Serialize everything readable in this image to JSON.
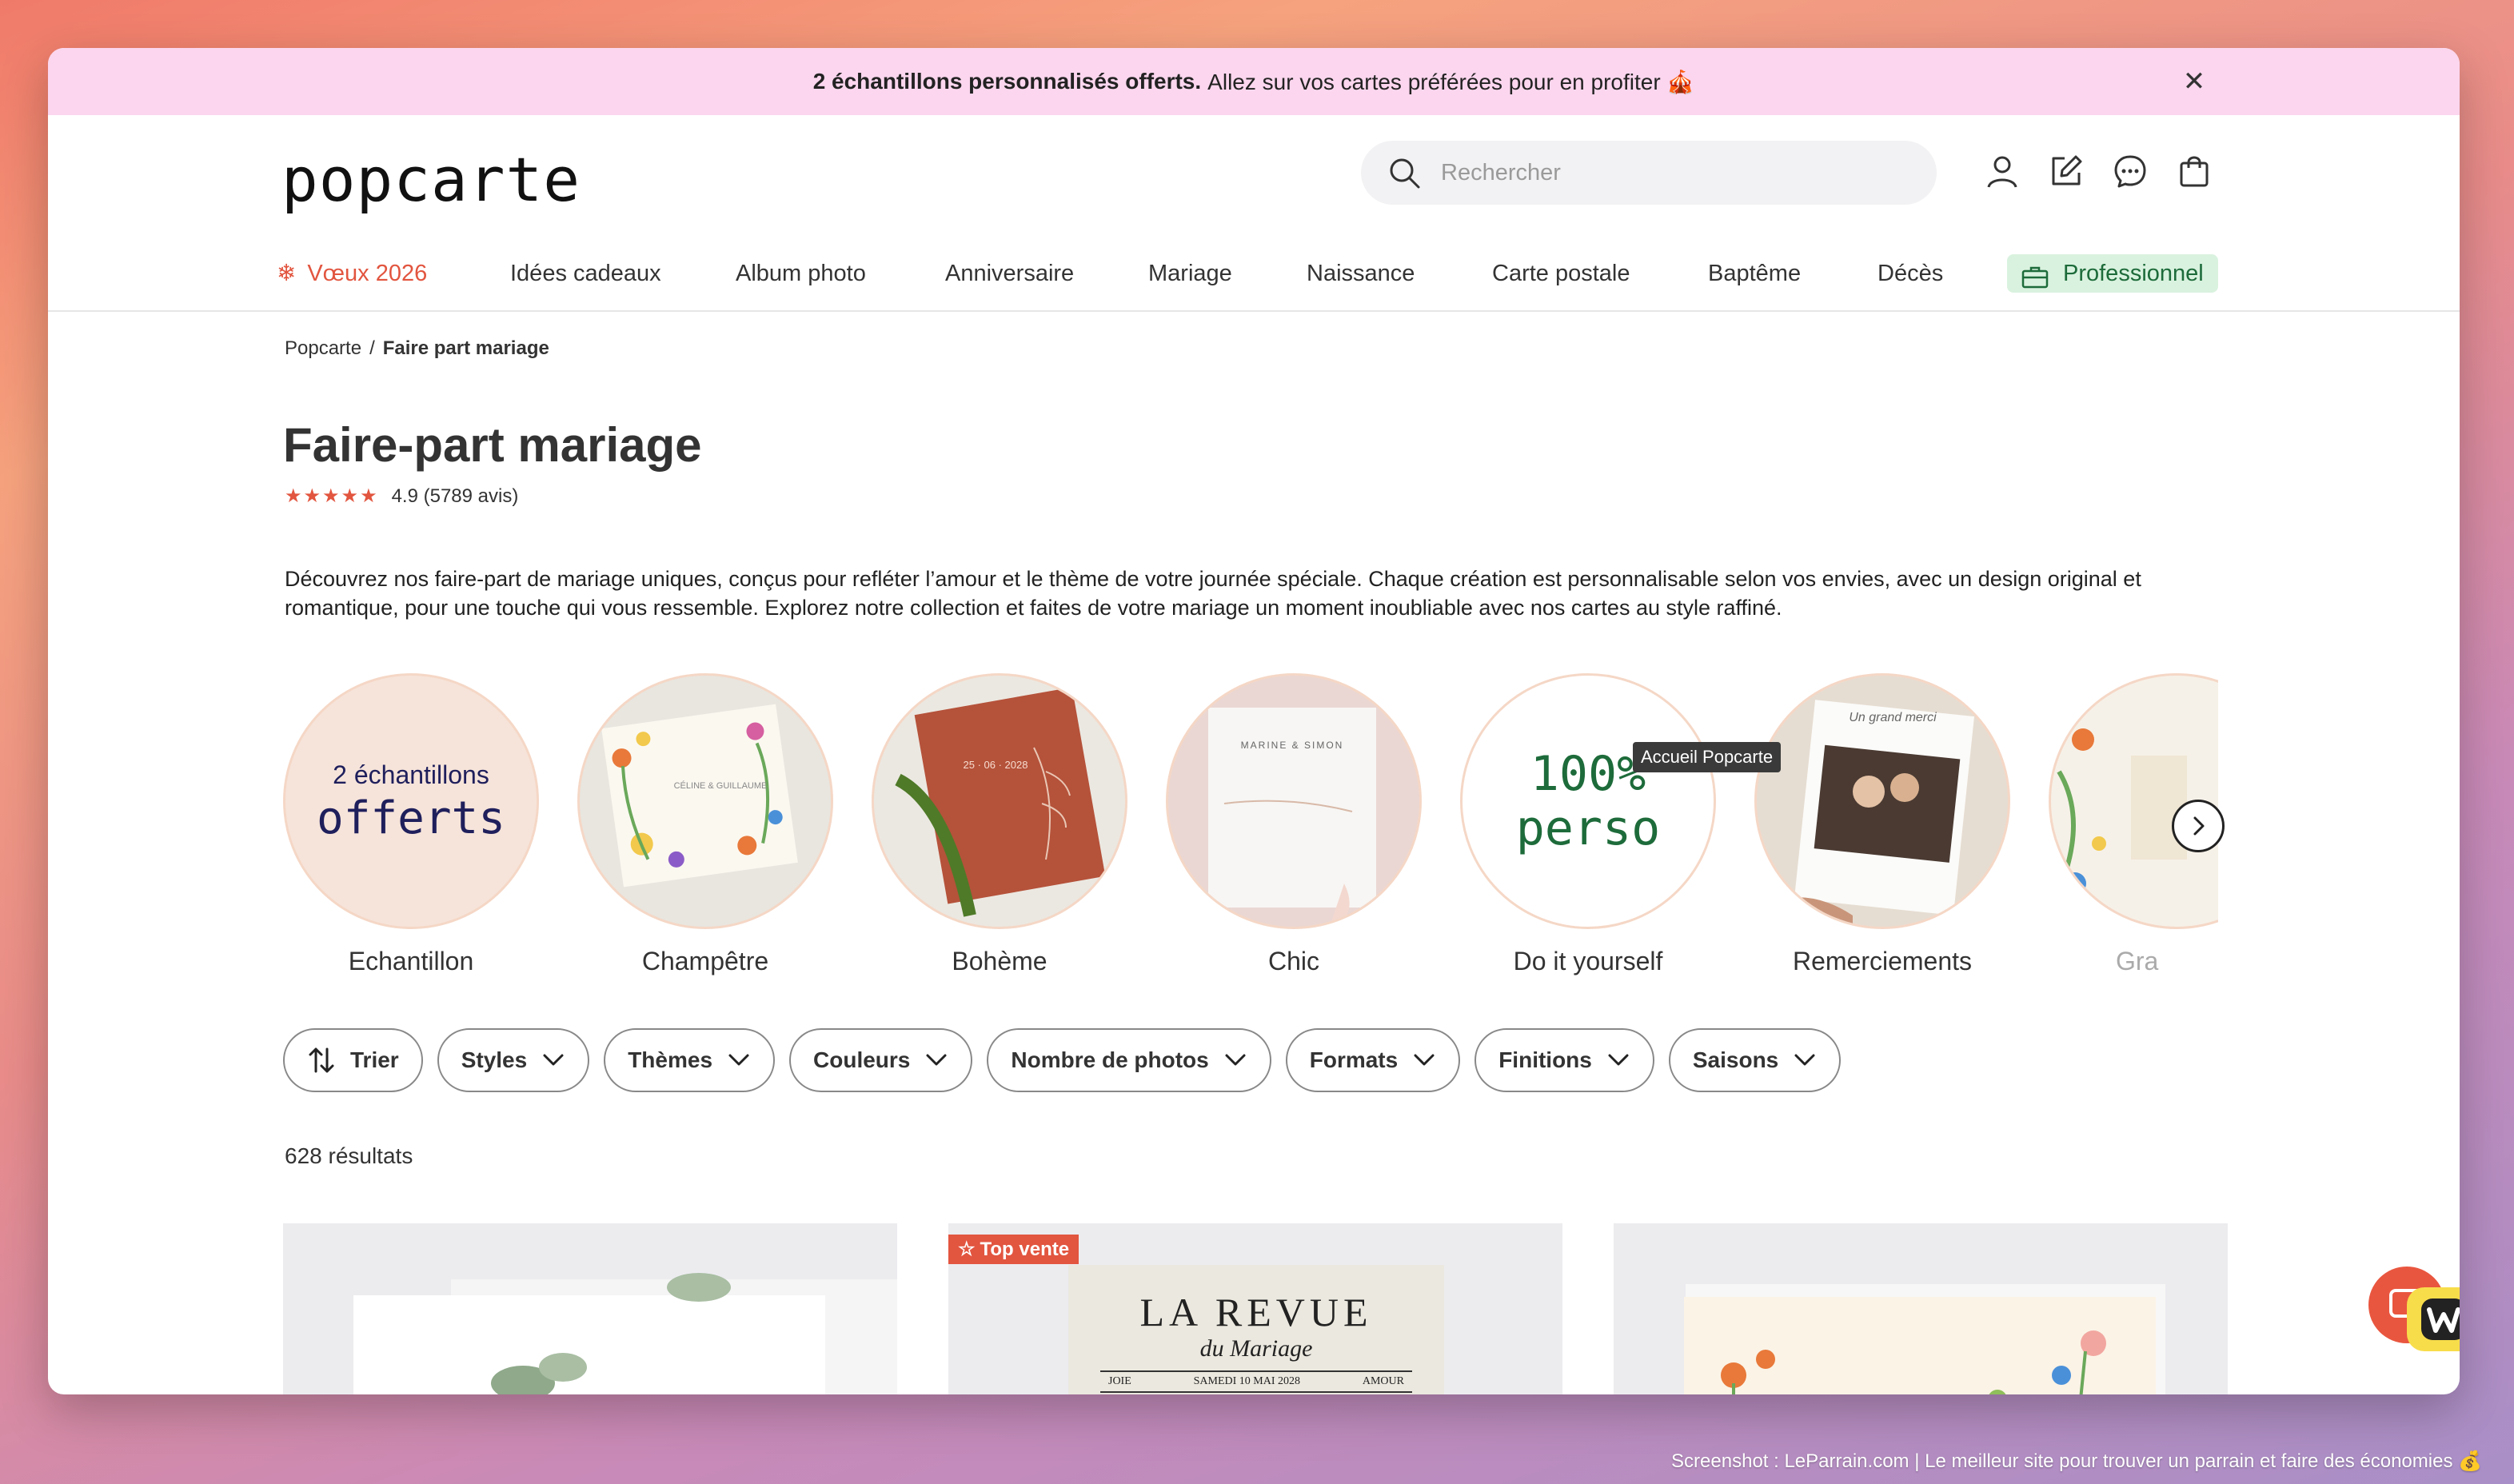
{
  "promo": {
    "bold": "2 échantillons personnalisés offerts.",
    "text": "Allez sur vos cartes préférées pour en profiter 🎪",
    "close": "✕"
  },
  "header": {
    "logo": "popcarte",
    "search_placeholder": "Rechercher"
  },
  "nav": {
    "items": [
      {
        "label": "Vœux 2026",
        "icon": "snowflake-icon"
      },
      {
        "label": "Idées cadeaux"
      },
      {
        "label": "Album photo"
      },
      {
        "label": "Anniversaire"
      },
      {
        "label": "Mariage"
      },
      {
        "label": "Naissance"
      },
      {
        "label": "Carte postale"
      },
      {
        "label": "Baptême"
      },
      {
        "label": "Décès"
      },
      {
        "label": "Professionnel",
        "icon": "briefcase-icon"
      }
    ]
  },
  "breadcrumb": {
    "home": "Popcarte",
    "sep": "/",
    "current": "Faire part mariage"
  },
  "page": {
    "title": "Faire-part mariage",
    "stars": "★★★★★",
    "rating": "4.9 (5789 avis)",
    "description": "Découvrez nos faire-part de mariage uniques, conçus pour refléter l’amour et le thème de votre journée spéciale. Chaque création est personnalisable selon vos envies, avec un design original et romantique, pour une touche qui vous ressemble. Explorez notre collection et faites de votre mariage un moment inoubliable avec nos cartes au style raffiné."
  },
  "categories": [
    {
      "label": "Echantillon",
      "line1": "2 échantillons",
      "line2": "offerts"
    },
    {
      "label": "Champêtre",
      "card_text": "CÉLINE & GUILLAUME"
    },
    {
      "label": "Bohème",
      "card_text": "25 · 06 · 2028"
    },
    {
      "label": "Chic",
      "card_text": "MARINE & SIMON"
    },
    {
      "label": "Do it yourself",
      "line1": "100%",
      "line2": "perso"
    },
    {
      "label": "Remerciements",
      "card_text": "Un grand merci"
    },
    {
      "label": "Gra"
    }
  ],
  "tooltip": "Accueil Popcarte",
  "filters": [
    {
      "label": "Trier"
    },
    {
      "label": "Styles"
    },
    {
      "label": "Thèmes"
    },
    {
      "label": "Couleurs"
    },
    {
      "label": "Nombre de photos"
    },
    {
      "label": "Formats"
    },
    {
      "label": "Finitions"
    },
    {
      "label": "Saisons"
    }
  ],
  "results": "628 résultats",
  "products": [
    {
      "badge": ""
    },
    {
      "badge": "Top vente",
      "title": "LA REVUE",
      "subtitle": "du Mariage",
      "left": "JOIE",
      "center": "SAMEDI 10 MAI 2028",
      "right": "AMOUR"
    },
    {
      "badge": ""
    }
  ],
  "footnote": "Screenshot : LeParrain.com | Le meilleur site pour trouver un parrain et faire des économies 💰",
  "colors": {
    "accent": "#e2553f",
    "promo_bg": "#fbd6ee",
    "pro_bg": "#d9f2df",
    "dark_text": "#333333"
  }
}
